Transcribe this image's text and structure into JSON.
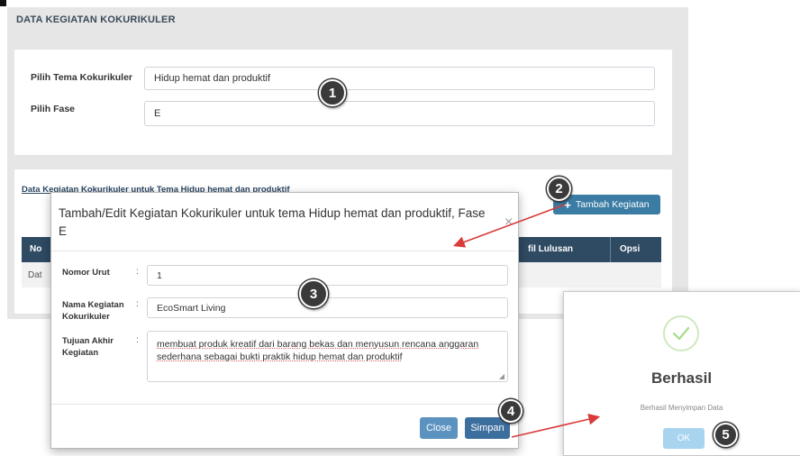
{
  "page": {
    "title": "DATA KEGIATAN KOKURIKULER",
    "tema_label": "Pilih Tema Kokurikuler",
    "tema_value": "Hidup hemat dan produktif",
    "fase_label": "Pilih Fase",
    "fase_value": "E",
    "section_title": "Data Kegiatan Kokurikuler untuk Tema Hidup hemat dan produktif",
    "add_button": "Tambah Kegiatan",
    "add_button_icon": "plus-icon",
    "table_headers": [
      "No",
      "fil Lulusan",
      "Opsi"
    ],
    "table_row_first": "Dat"
  },
  "modal": {
    "title": "Tambah/Edit Kegiatan Kokurikuler untuk tema Hidup hemat dan produktif, Fase E",
    "close_symbol": "×",
    "nomor_label": "Nomor Urut",
    "nomor_value": "1",
    "nama_label": "Nama Kegiatan Kokurikuler",
    "nama_value": "EcoSmart Living",
    "tujuan_label": "Tujuan Akhir Kegiatan",
    "tujuan_value": "membuat produk kreatif dari barang bekas dan menyusun rencana anggaran sederhana sebagai bukti praktik hidup hemat dan produktif",
    "colon": ":",
    "close_button": "Close",
    "save_button": "Simpan"
  },
  "success": {
    "title": "Berhasil",
    "message": "Berhasil Menyimpan Data",
    "ok_button": "OK",
    "icon": "check-icon"
  },
  "annotations": [
    "1",
    "2",
    "3",
    "4",
    "5"
  ],
  "colors": {
    "badge": "#3a3a3a",
    "arrow": "#d93b3b",
    "teal_button": "#3a7ca3",
    "close_button": "#5b92c0",
    "ok_button": "#a8d4f0",
    "success_check": "#a5dc86"
  }
}
